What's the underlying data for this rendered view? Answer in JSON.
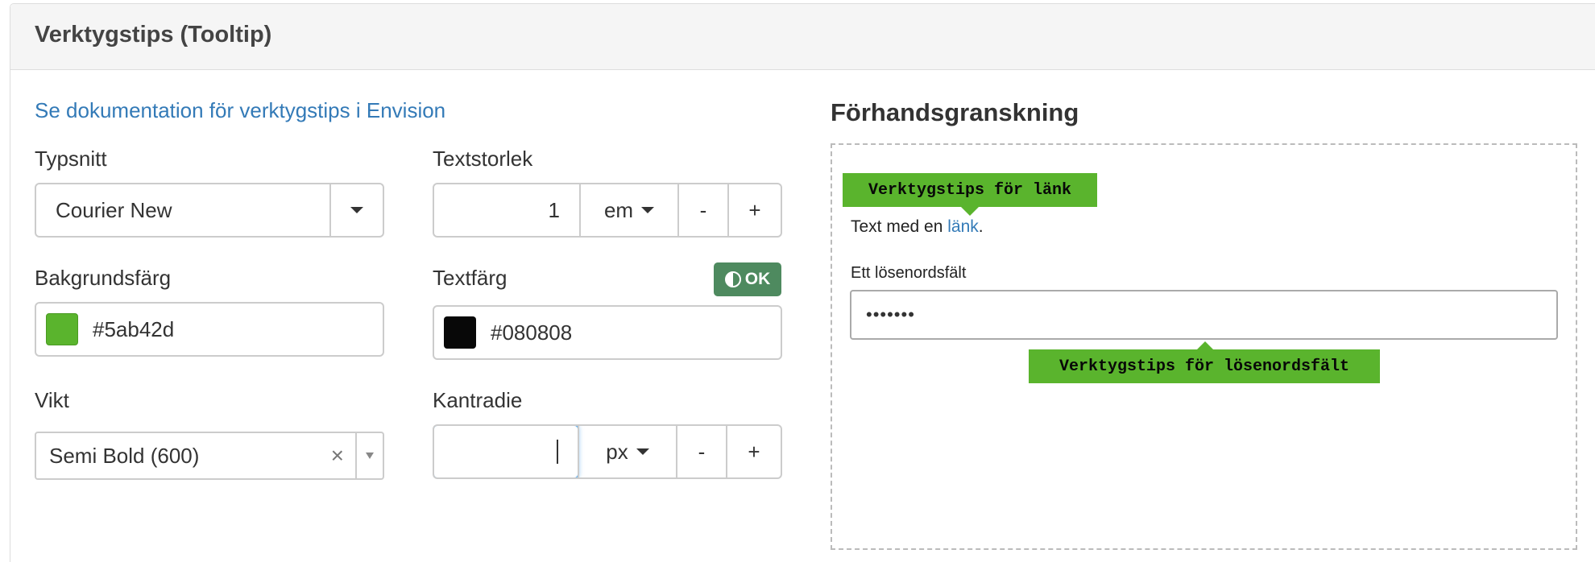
{
  "panel": {
    "title": "Verktygstips (Tooltip)"
  },
  "doc_link": "Se dokumentation för verktygstips i Envision",
  "font": {
    "label": "Typsnitt",
    "value": "Courier New"
  },
  "text_size": {
    "label": "Textstorlek",
    "value": "1",
    "unit": "em",
    "minus": "-",
    "plus": "+"
  },
  "background_color": {
    "label": "Bakgrundsfärg",
    "value": "#5ab42d",
    "swatch": "#5ab42d"
  },
  "text_color": {
    "label": "Textfärg",
    "value": "#080808",
    "swatch": "#080808",
    "contrast_badge": "OK"
  },
  "weight": {
    "label": "Vikt",
    "value": "Semi Bold (600)",
    "clear": "×"
  },
  "border_radius": {
    "label": "Kantradie",
    "value": "",
    "unit": "px",
    "minus": "-",
    "plus": "+"
  },
  "preview": {
    "title": "Förhandsgranskning",
    "link_tooltip": "Verktygstips för länk",
    "text_before": "Text med en ",
    "link_text": "länk",
    "text_after": ".",
    "password_label": "Ett lösenordsfält",
    "password_value": "•••••••",
    "password_tooltip": "Verktygstips för lösenordsfält"
  }
}
